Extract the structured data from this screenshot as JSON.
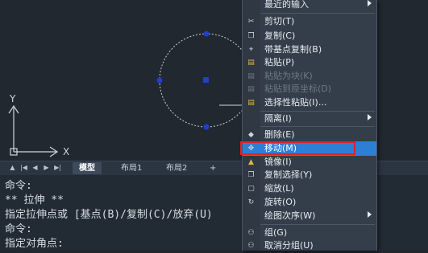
{
  "canvas": {
    "ucs_y_label": "Y",
    "ucs_x_label": "X"
  },
  "layout_tabs": {
    "nav_first": "|◀",
    "nav_prev": "◀",
    "nav_next": "▶",
    "nav_last": "▶|",
    "tabs": [
      {
        "label": "模型",
        "active": true
      },
      {
        "label": "布局1",
        "active": false
      },
      {
        "label": "布局2",
        "active": false
      }
    ],
    "add_label": "+"
  },
  "command_line": [
    "命令:",
    "** 拉伸 **",
    "指定拉伸点或 [基点(B)/复制(C)/放弃(U)",
    "命令:",
    "指定对角点:"
  ],
  "context_menu": {
    "items": [
      {
        "label": "最近的输入",
        "icon": "",
        "submenu": true
      },
      {
        "label": "剪切(T)",
        "icon": "scissors-icon"
      },
      {
        "label": "复制(C)",
        "icon": "copy-icon"
      },
      {
        "label": "带基点复制(B)",
        "icon": "copy-basepoint-icon"
      },
      {
        "label": "粘贴(P)",
        "icon": "paste-icon"
      },
      {
        "label": "粘贴为块(K)",
        "icon": "paste-block-icon",
        "disabled": true
      },
      {
        "label": "粘贴到原坐标(D)",
        "icon": "paste-orig-icon",
        "disabled": true
      },
      {
        "label": "选择性粘贴(I)...",
        "icon": "paste-special-icon"
      },
      {
        "label": "隔离(I)",
        "icon": "",
        "submenu": true
      },
      {
        "label": "删除(E)",
        "icon": "erase-icon"
      },
      {
        "label": "移动(M)",
        "icon": "move-icon",
        "highlighted": true
      },
      {
        "label": "镜像(I)",
        "icon": "mirror-icon"
      },
      {
        "label": "复制选择(Y)",
        "icon": "copy-selection-icon"
      },
      {
        "label": "缩放(L)",
        "icon": "scale-icon"
      },
      {
        "label": "旋转(O)",
        "icon": "rotate-icon"
      },
      {
        "label": "绘图次序(W)",
        "icon": "",
        "submenu": true
      },
      {
        "label": "组(G)",
        "icon": "group-icon"
      },
      {
        "label": "取消分组(U)",
        "icon": "ungroup-icon"
      }
    ]
  },
  "colors": {
    "canvas_bg": "#212830",
    "menu_bg": "#343e4a",
    "highlight": "#2d7fd6",
    "annotation_box": "#d8262b",
    "grip": "#1e3fd0"
  }
}
